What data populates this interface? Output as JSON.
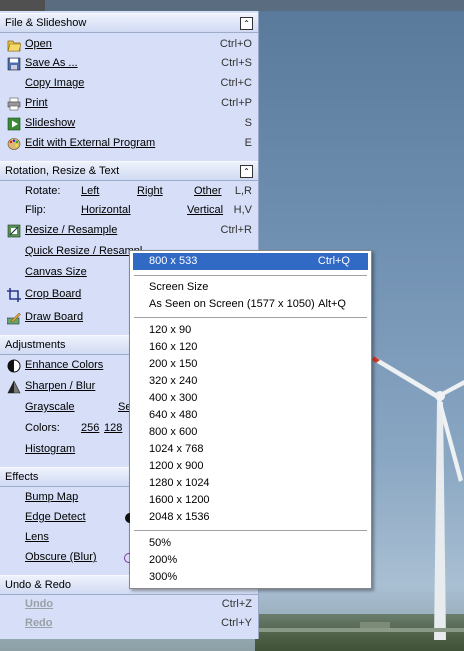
{
  "file_section": {
    "title": "File & Slideshow",
    "collapse_glyph": "⌃",
    "items": [
      {
        "label": "Open",
        "shortcut": "Ctrl+O",
        "icon": "folder-icon"
      },
      {
        "label": "Save As ...",
        "shortcut": "Ctrl+S",
        "icon": "disk-icon"
      },
      {
        "label": "Copy Image",
        "shortcut": "Ctrl+C"
      },
      {
        "label": "Print",
        "shortcut": "Ctrl+P",
        "icon": "printer-icon"
      },
      {
        "label": "Slideshow",
        "shortcut": "S",
        "icon": "slideshow-icon"
      },
      {
        "label": "Edit with External Program",
        "shortcut": "E",
        "icon": "palette-icon"
      }
    ]
  },
  "rotation_section": {
    "title": "Rotation, Resize & Text",
    "collapse_glyph": "⌃",
    "rotate": {
      "label": "Rotate:",
      "left": "Left",
      "right": "Right",
      "other": "Other",
      "shortcut": "L,R"
    },
    "flip": {
      "label": "Flip:",
      "horizontal": "Horizontal",
      "vertical": "Vertical",
      "shortcut": "H,V"
    },
    "resize": {
      "label": "Resize / Resample",
      "shortcut": "Ctrl+R",
      "icon": "resize-icon"
    },
    "quick_resize": {
      "label": "Quick Resize / Resampl"
    },
    "canvas_size": {
      "label": "Canvas Size"
    },
    "crop_board": {
      "label": "Crop Board",
      "icon": "crop-icon"
    },
    "draw_board": {
      "label": "Draw Board",
      "icon": "draw-icon"
    }
  },
  "adjust_section": {
    "title": "Adjustments",
    "enhance": {
      "label": "Enhance Colors",
      "icon": "enhance-icon"
    },
    "sharpen": {
      "label": "Sharpen / Blur",
      "icon": "sharpen-icon"
    },
    "grayscale": {
      "label": "Grayscale",
      "extra": "Se"
    },
    "colors": {
      "label": "Colors:",
      "v1": "256",
      "v2": "128"
    },
    "histogram": {
      "label": "Histogram"
    }
  },
  "effects_section": {
    "title": "Effects",
    "items": [
      "Bump Map",
      "Edge Detect",
      "Lens",
      "Obscure (Blur)"
    ]
  },
  "undo_section": {
    "title": "Undo & Redo",
    "undo": {
      "label": "Undo",
      "shortcut": "Ctrl+Z"
    },
    "redo": {
      "label": "Redo",
      "shortcut": "Ctrl+Y"
    }
  },
  "quick_resize_menu": {
    "items": [
      {
        "label": "800 x 533",
        "shortcut": "Ctrl+Q",
        "selected": true
      },
      {
        "label": "Screen Size"
      },
      {
        "label": "As Seen on Screen (1577 x 1050)",
        "shortcut": "Alt+Q"
      },
      {
        "label": "120 x 90"
      },
      {
        "label": "160 x 120"
      },
      {
        "label": "200 x 150"
      },
      {
        "label": "320 x 240"
      },
      {
        "label": "400 x 300"
      },
      {
        "label": "640 x 480"
      },
      {
        "label": "800 x 600"
      },
      {
        "label": "1024 x 768"
      },
      {
        "label": "1200 x 900"
      },
      {
        "label": "1280 x 1024"
      },
      {
        "label": "1600 x 1200"
      },
      {
        "label": "2048 x 1536"
      },
      {
        "label": "50%"
      },
      {
        "label": "200%"
      },
      {
        "label": "300%"
      }
    ]
  },
  "colors": {
    "panel": "#d6dff7",
    "selection": "#316ac5",
    "disabled": "#9aa0a8"
  }
}
